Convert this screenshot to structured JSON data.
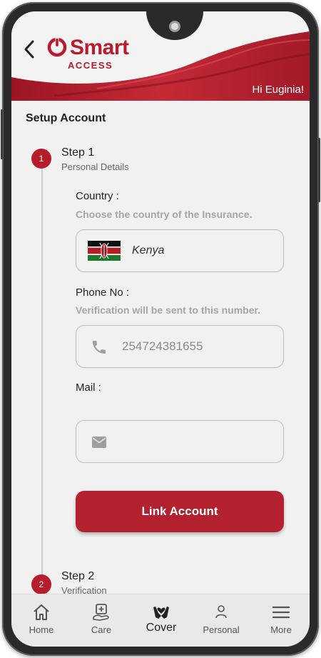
{
  "header": {
    "brand_name": "Smart",
    "brand_sub": "ACCESS",
    "greeting": "Hi Euginia!"
  },
  "page": {
    "title": "Setup Account"
  },
  "steps": [
    {
      "number": "1",
      "title": "Step 1",
      "subtitle": "Personal Details"
    },
    {
      "number": "2",
      "title": "Step 2",
      "subtitle": "Verification"
    }
  ],
  "form": {
    "country": {
      "label": "Country :",
      "hint": "Choose the country of the Insurance.",
      "value": "Kenya",
      "flag_icon": "kenya-flag-icon"
    },
    "phone": {
      "label": "Phone No :",
      "hint": "Verification will be sent to this number.",
      "value": "254724381655",
      "icon": "phone-icon"
    },
    "mail": {
      "label": "Mail :",
      "value": "",
      "icon": "mail-icon"
    },
    "submit_label": "Link Account"
  },
  "nav": {
    "items": [
      {
        "label": "Home",
        "icon": "home-icon"
      },
      {
        "label": "Care",
        "icon": "care-icon"
      },
      {
        "label": "Cover",
        "icon": "cover-icon",
        "active": true
      },
      {
        "label": "Personal",
        "icon": "person-icon"
      },
      {
        "label": "More",
        "icon": "menu-icon"
      }
    ]
  },
  "colors": {
    "brand_red": "#b71c2c",
    "button_red": "#b3202e",
    "screen_bg": "#f1f1f1",
    "hint_gray": "#a5a5a5"
  }
}
